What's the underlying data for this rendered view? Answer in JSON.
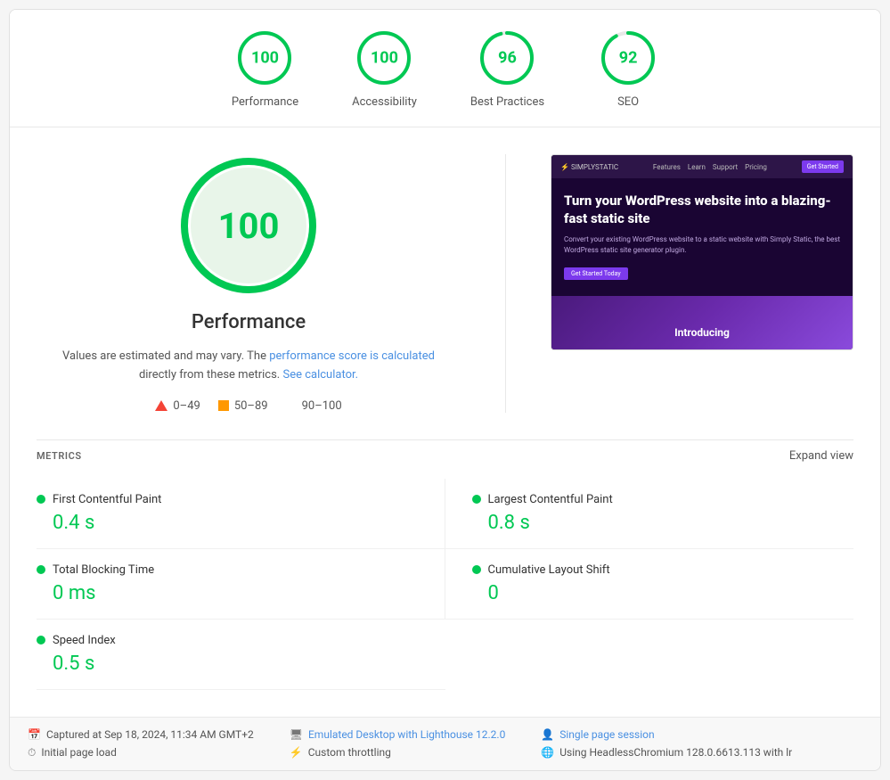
{
  "scores": [
    {
      "id": "performance",
      "label": "Performance",
      "value": 100,
      "color": "green",
      "pct": 100
    },
    {
      "id": "accessibility",
      "label": "Accessibility",
      "value": 100,
      "color": "green",
      "pct": 100
    },
    {
      "id": "best-practices",
      "label": "Best Practices",
      "value": 96,
      "color": "green",
      "pct": 96
    },
    {
      "id": "seo",
      "label": "SEO",
      "value": 92,
      "color": "green",
      "pct": 92
    }
  ],
  "main": {
    "score_value": "100",
    "section_title": "Performance",
    "description_prefix": "Values are estimated and may vary. The ",
    "description_link_text": "performance score is calculated",
    "description_suffix": " directly from these metrics.",
    "see_calculator": "See calculator.",
    "legend": [
      {
        "type": "triangle",
        "range": "0–49"
      },
      {
        "type": "square",
        "range": "50–89"
      },
      {
        "type": "dot",
        "range": "90–100"
      }
    ]
  },
  "screenshot": {
    "site_name": "SIMPLYSTATIC",
    "nav_links": [
      "Features",
      "Learn",
      "Support",
      "Pricing"
    ],
    "cta_button": "Get Started",
    "headline": "Turn your WordPress website into a blazing-fast static site",
    "subtext": "Convert your existing WordPress website to a static website with Simply Static, the best WordPress static site generator plugin.",
    "hero_cta": "Get Started Today",
    "introducing": "Introducing"
  },
  "metrics": {
    "section_label": "METRICS",
    "expand_label": "Expand view",
    "items": [
      {
        "id": "fcp",
        "name": "First Contentful Paint",
        "value": "0.4 s",
        "color": "green"
      },
      {
        "id": "lcp",
        "name": "Largest Contentful Paint",
        "value": "0.8 s",
        "color": "green"
      },
      {
        "id": "tbt",
        "name": "Total Blocking Time",
        "value": "0 ms",
        "color": "green"
      },
      {
        "id": "cls",
        "name": "Cumulative Layout Shift",
        "value": "0",
        "color": "green"
      },
      {
        "id": "si",
        "name": "Speed Index",
        "value": "0.5 s",
        "color": "green"
      }
    ]
  },
  "footer": {
    "col1": [
      {
        "icon": "📅",
        "text": "Captured at Sep 18, 2024, 11:34 AM GMT+2"
      },
      {
        "icon": "⏱",
        "text": "Initial page load"
      }
    ],
    "col2": [
      {
        "icon": "🖥",
        "text": "Emulated Desktop with Lighthouse 12.2.0",
        "link": true
      },
      {
        "icon": "⚡",
        "text": "Custom throttling"
      }
    ],
    "col3": [
      {
        "icon": "👤",
        "text": "Single page session",
        "link": true
      },
      {
        "icon": "🌐",
        "text": "Using HeadlessChromium 128.0.6613.113 with lr"
      }
    ]
  }
}
